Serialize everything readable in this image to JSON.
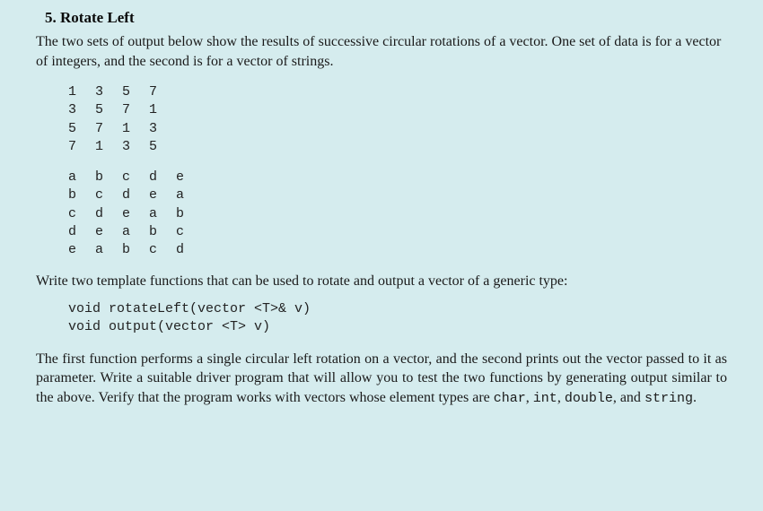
{
  "heading": "5. Rotate Left",
  "intro": "The two sets of output below show the results of successive circular rotations of a vector. One set of data is for a vector of integers, and the second is for a vector of strings.",
  "int_output": [
    [
      "1",
      "3",
      "5",
      "7"
    ],
    [
      "3",
      "5",
      "7",
      "1"
    ],
    [
      "5",
      "7",
      "1",
      "3"
    ],
    [
      "7",
      "1",
      "3",
      "5"
    ]
  ],
  "str_output": [
    [
      "a",
      "b",
      "c",
      "d",
      "e"
    ],
    [
      "b",
      "c",
      "d",
      "e",
      "a"
    ],
    [
      "c",
      "d",
      "e",
      "a",
      "b"
    ],
    [
      "d",
      "e",
      "a",
      "b",
      "c"
    ],
    [
      "e",
      "a",
      "b",
      "c",
      "d"
    ]
  ],
  "mid": "Write two template functions that can be used to rotate and output a vector of a generic type:",
  "code": {
    "line1": "void rotateLeft(vector <T>& v)",
    "line2": "void output(vector <T> v)"
  },
  "closing_parts": {
    "p1": "The first function performs a single circular left rotation on a vector, and the second prints out the vector passed to it as parameter. Write a suitable driver program that will allow you to test the two functions by generating output similar to the above. Verify that the program works with vectors whose element types are ",
    "t1": "char",
    "c1": ", ",
    "t2": "int",
    "c2": ", ",
    "t3": "double",
    "c3": ", and ",
    "t4": "string",
    "c4": "."
  }
}
